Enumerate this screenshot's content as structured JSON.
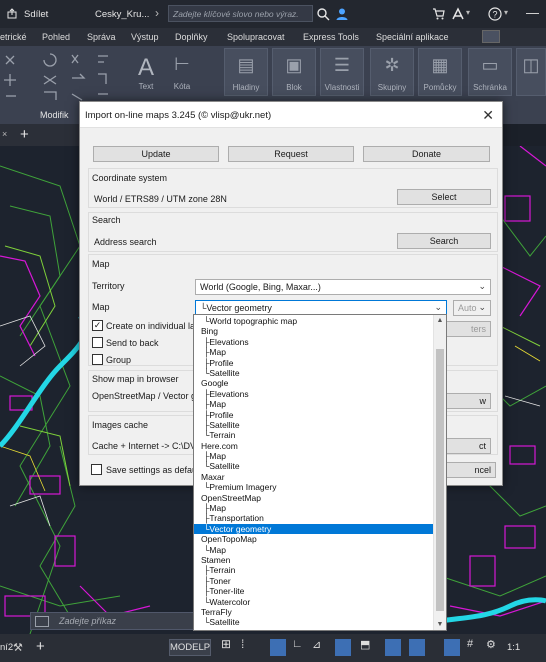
{
  "titlebar": {
    "share": "Sdílet",
    "document": "Cesky_Kru...",
    "search_placeholder": "Zadejte klíčové slovo nebo výraz."
  },
  "ribbon": {
    "tabs": [
      "etrické",
      "Pohled",
      "Správa",
      "Výstup",
      "Doplňky",
      "Spolupracovat",
      "Express Tools",
      "Speciální aplikace"
    ],
    "buttons": [
      "Text",
      "Kóta",
      "Hladiny",
      "Blok",
      "Vlastnosti",
      "Skupiny",
      "Pomůcky",
      "Schránka"
    ],
    "panel_label": "Modifik"
  },
  "command_line": {
    "placeholder": "Zadejte příkaz"
  },
  "statusbar": {
    "layout_tab": "ní2",
    "model_label": "MODELP",
    "scale": "1:1"
  },
  "dialog": {
    "title": "Import on-line maps 3.245 (© vlisp@ukr.net)",
    "buttons": {
      "update": "Update",
      "request": "Request",
      "donate": "Donate",
      "select": "Select",
      "search": "Search",
      "ters": "ters",
      "w": "w",
      "ct": "ct",
      "ncel": "ncel"
    },
    "coordinate_system": {
      "header": "Coordinate system",
      "value": "World / ETRS89 / UTM zone 28N"
    },
    "search": {
      "header": "Search",
      "label": "Address search"
    },
    "map": {
      "header": "Map",
      "territory_label": "Territory",
      "territory_value": "World (Google, Bing, Maxar...)",
      "map_label": "Map",
      "map_value": "└Vector geometry",
      "auto": "Auto",
      "create_individual": "Create on individual laye",
      "send_to_back": "Send to back",
      "group": "Group"
    },
    "browser": {
      "header": "Show map in browser",
      "value": "OpenStreetMap / Vector ge"
    },
    "cache": {
      "header": "Images cache",
      "value": "Cache + Internet  ->  C:\\DV"
    },
    "save_settings": "Save settings as default"
  },
  "dropdown": {
    "items": [
      " └World topographic map",
      "Bing",
      " ├Elevations",
      " ├Map",
      " ├Profile",
      " └Satellite",
      "Google",
      " ├Elevations",
      " ├Map",
      " ├Profile",
      " ├Satellite",
      " └Terrain",
      "Here.com",
      " ├Map",
      " └Satellite",
      "Maxar",
      " └Premium Imagery",
      "OpenStreetMap",
      " ├Map",
      " ├Transportation",
      " └Vector geometry",
      "OpenTopoMap",
      " └Map",
      "Stamen",
      " ├Terrain",
      " ├Toner",
      " ├Toner-lite",
      " └Watercolor",
      "TerraFly",
      " └Satellite"
    ],
    "selected_index": 20
  },
  "colors": {
    "accent": "#0078d7",
    "canvas": "#1d232e",
    "magenta": "#d617d6",
    "cyan": "#23d7e6",
    "green": "#7fd13a"
  }
}
